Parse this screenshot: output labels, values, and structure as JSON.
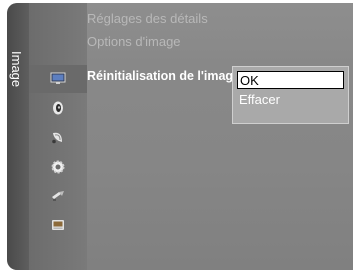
{
  "side_tab": {
    "label": "Image"
  },
  "menu": {
    "items": [
      {
        "label": "Réglages des détails",
        "state": "disabled"
      },
      {
        "label": "Options d'image",
        "state": "disabled"
      },
      {
        "label": "Réinitialisation de l'image",
        "state": "selected"
      }
    ]
  },
  "popup": {
    "options": [
      {
        "label": "OK",
        "state": "focused"
      },
      {
        "label": "Effacer",
        "state": "normal"
      }
    ]
  },
  "icons": [
    "picture-icon",
    "sound-icon",
    "satellite-dish-icon",
    "gear-icon",
    "input-icon",
    "application-icon"
  ],
  "colors": {
    "panel": "#888888",
    "selected_text": "#ffffff",
    "disabled_text": "#b8b8b8",
    "focus_bg": "#ffffff"
  }
}
